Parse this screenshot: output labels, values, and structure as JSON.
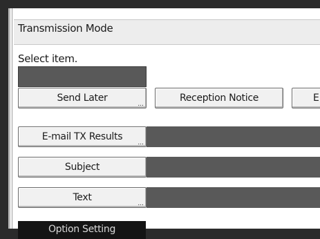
{
  "window": {
    "title": "Transmission Mode",
    "prompt": "Select item."
  },
  "buttons": {
    "send_later": "Send Later",
    "reception_notice": "Reception Notice",
    "partial_right": "E",
    "email_tx_results": "E-mail TX Results",
    "subject": "Subject",
    "text": "Text",
    "option_setting": "Option Setting"
  },
  "ellipsis": "..."
}
